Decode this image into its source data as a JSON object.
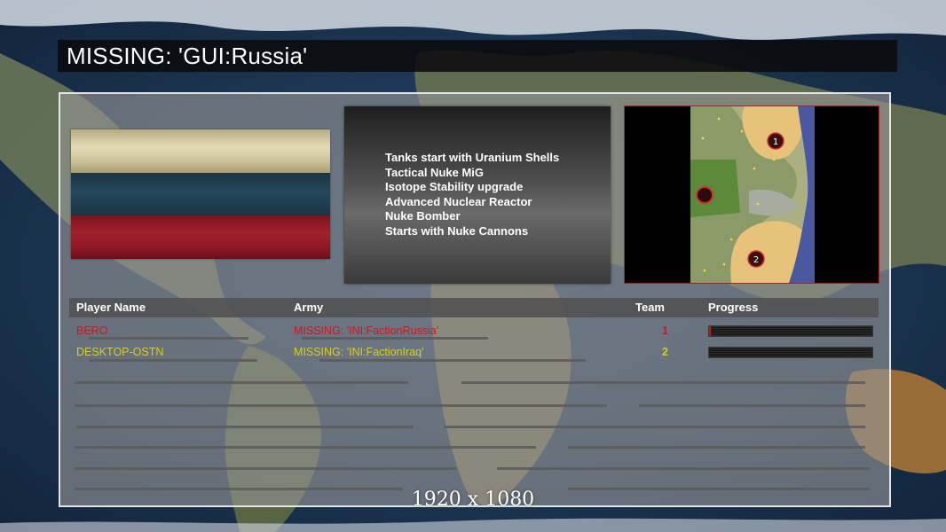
{
  "title": "MISSING: 'GUI:Russia'",
  "faction": {
    "flag_colors": [
      "#d8cfa8",
      "#1f3f52",
      "#9b1d2c"
    ],
    "features": [
      "Tanks start with Uranium Shells",
      "Tactical Nuke MiG",
      "Isotope Stability upgrade",
      "Advanced Nuclear Reactor",
      "Nuke Bomber",
      "Starts with Nuke Cannons"
    ]
  },
  "minimap": {
    "start_markers": [
      "1",
      "2"
    ]
  },
  "table": {
    "headers": {
      "player": "Player Name",
      "army": "Army",
      "team": "Team",
      "progress": "Progress"
    },
    "rows": [
      {
        "player": "BERO",
        "army": "MISSING: 'INI:FactionRussia'",
        "team": "1",
        "progress": 0.01,
        "color": "#d4141c"
      },
      {
        "player": "DESKTOP-OSTN",
        "army": "MISSING: 'INI:FactionIraq'",
        "team": "2",
        "progress": 0.0,
        "color": "#d8d01a"
      }
    ]
  },
  "resolution_label": "1920 x 1080"
}
